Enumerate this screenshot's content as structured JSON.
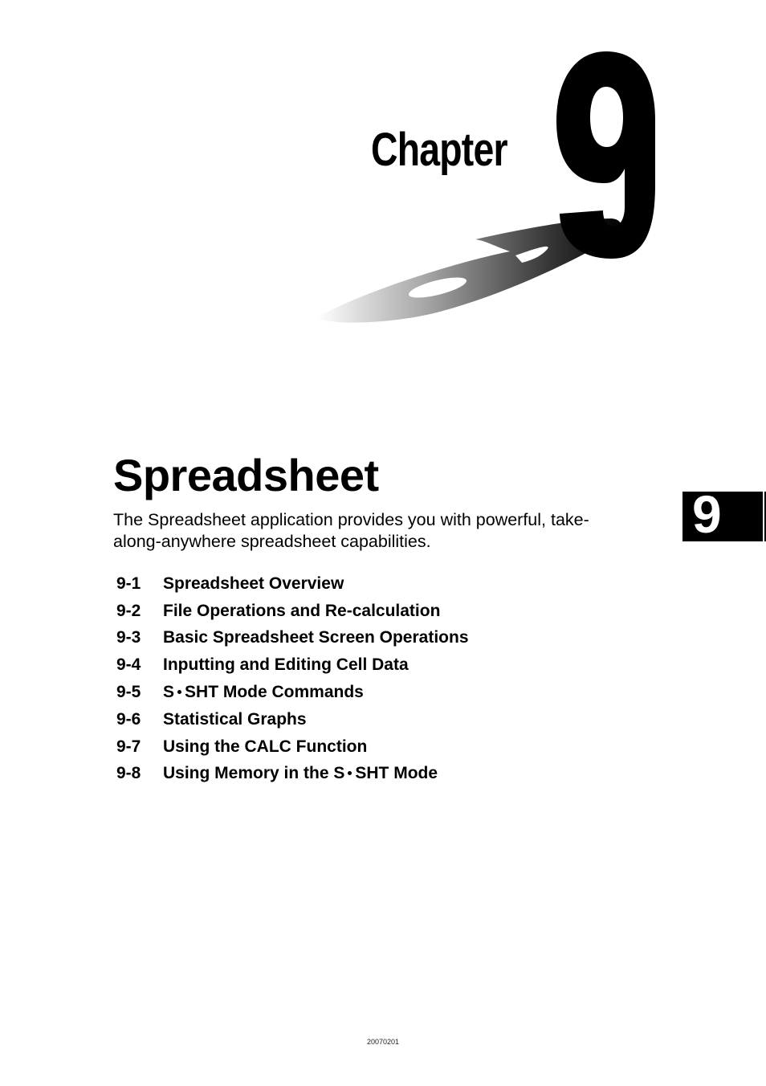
{
  "header": {
    "chapter_label": "Chapter",
    "chapter_number": "9"
  },
  "page": {
    "title": "Spreadsheet",
    "intro_lines": [
      "The Spreadsheet application provides you with powerful, take-",
      "along-anywhere spreadsheet capabilities."
    ]
  },
  "toc": [
    {
      "num": "9-1",
      "title": "Spreadsheet Overview"
    },
    {
      "num": "9-2",
      "title": "File Operations and Re-calculation"
    },
    {
      "num": "9-3",
      "title": "Basic Spreadsheet Screen Operations"
    },
    {
      "num": "9-4",
      "title": "Inputting and Editing Cell Data"
    },
    {
      "num": "9-5",
      "title_pre": "S",
      "title_post": "SHT Mode Commands"
    },
    {
      "num": "9-6",
      "title": "Statistical Graphs"
    },
    {
      "num": "9-7",
      "title": "Using the CALC Function"
    },
    {
      "num": "9-8",
      "title_pre": "Using Memory in the S",
      "title_post": "SHT Mode"
    }
  ],
  "side_tab": {
    "number": "9"
  },
  "footer": {
    "code": "20070201"
  }
}
